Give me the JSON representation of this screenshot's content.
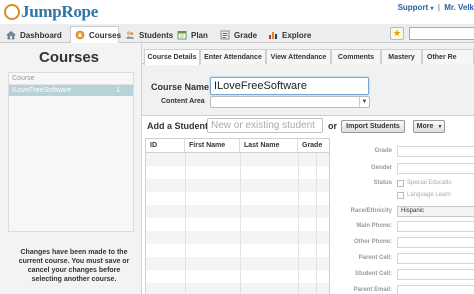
{
  "header": {
    "logo_text": "JumpRope",
    "support_link": "Support",
    "support_caret": "▾",
    "separator": "|",
    "user_link": "Mr. Velk"
  },
  "nav": {
    "items": [
      {
        "label": "Dashboard",
        "icon": "home-icon"
      },
      {
        "label": "Courses",
        "icon": "courses-icon"
      },
      {
        "label": "Students",
        "icon": "students-icon"
      },
      {
        "label": "Plan",
        "icon": "plan-icon"
      },
      {
        "label": "Grade",
        "icon": "grade-icon"
      },
      {
        "label": "Explore",
        "icon": "explore-icon"
      }
    ],
    "active": "Courses"
  },
  "left_panel": {
    "title": "Courses",
    "list_header": "Course",
    "courses": [
      {
        "name": "ILoveFreeSoftware",
        "count": "1"
      }
    ],
    "message": "Changes have been made to the current course. You must save or cancel your changes before selecting another course."
  },
  "tabs": [
    {
      "label": "Course Details",
      "active": true
    },
    {
      "label": "Enter Attendance",
      "active": false
    },
    {
      "label": "View Attendance",
      "active": false
    },
    {
      "label": "Comments",
      "active": false
    },
    {
      "label": "Mastery",
      "active": false
    },
    {
      "label": "Other Re",
      "active": false
    }
  ],
  "course_form": {
    "course_name_label": "Course Name",
    "required_marker": "•",
    "course_name_value": "ILoveFreeSoftware",
    "content_area_label": "Content Area",
    "content_area_value": "",
    "select_arrow": "▼"
  },
  "students": {
    "add_label": "Add a Student:",
    "input_placeholder": "New or existing student",
    "or_label": "or",
    "import_button": "Import Students",
    "more_button": "More",
    "more_caret": "▼",
    "columns": [
      "ID",
      "First Name",
      "Last Name",
      "Grade"
    ],
    "rows": []
  },
  "detail_form": {
    "grade_label": "Grade",
    "gender_label": "Gender",
    "status_label": "Status",
    "special_education_label": "Special Educatio",
    "language_learner_label": "Language Learn",
    "race_label": "Race/Ethnicity",
    "race_value": "Hispanic",
    "main_phone_label": "Main Phone:",
    "other_phone_label": "Other Phone:",
    "parent_cell_label": "Parent Cell:",
    "student_cell_label": "Student Cell:",
    "parent_email_label": "Parent Email:"
  },
  "colors": {
    "logo_blue": "#2f76a6",
    "logo_orange": "#d98a2b",
    "selected_row": "#b7d2d8",
    "link_blue": "#2b5ea6"
  }
}
